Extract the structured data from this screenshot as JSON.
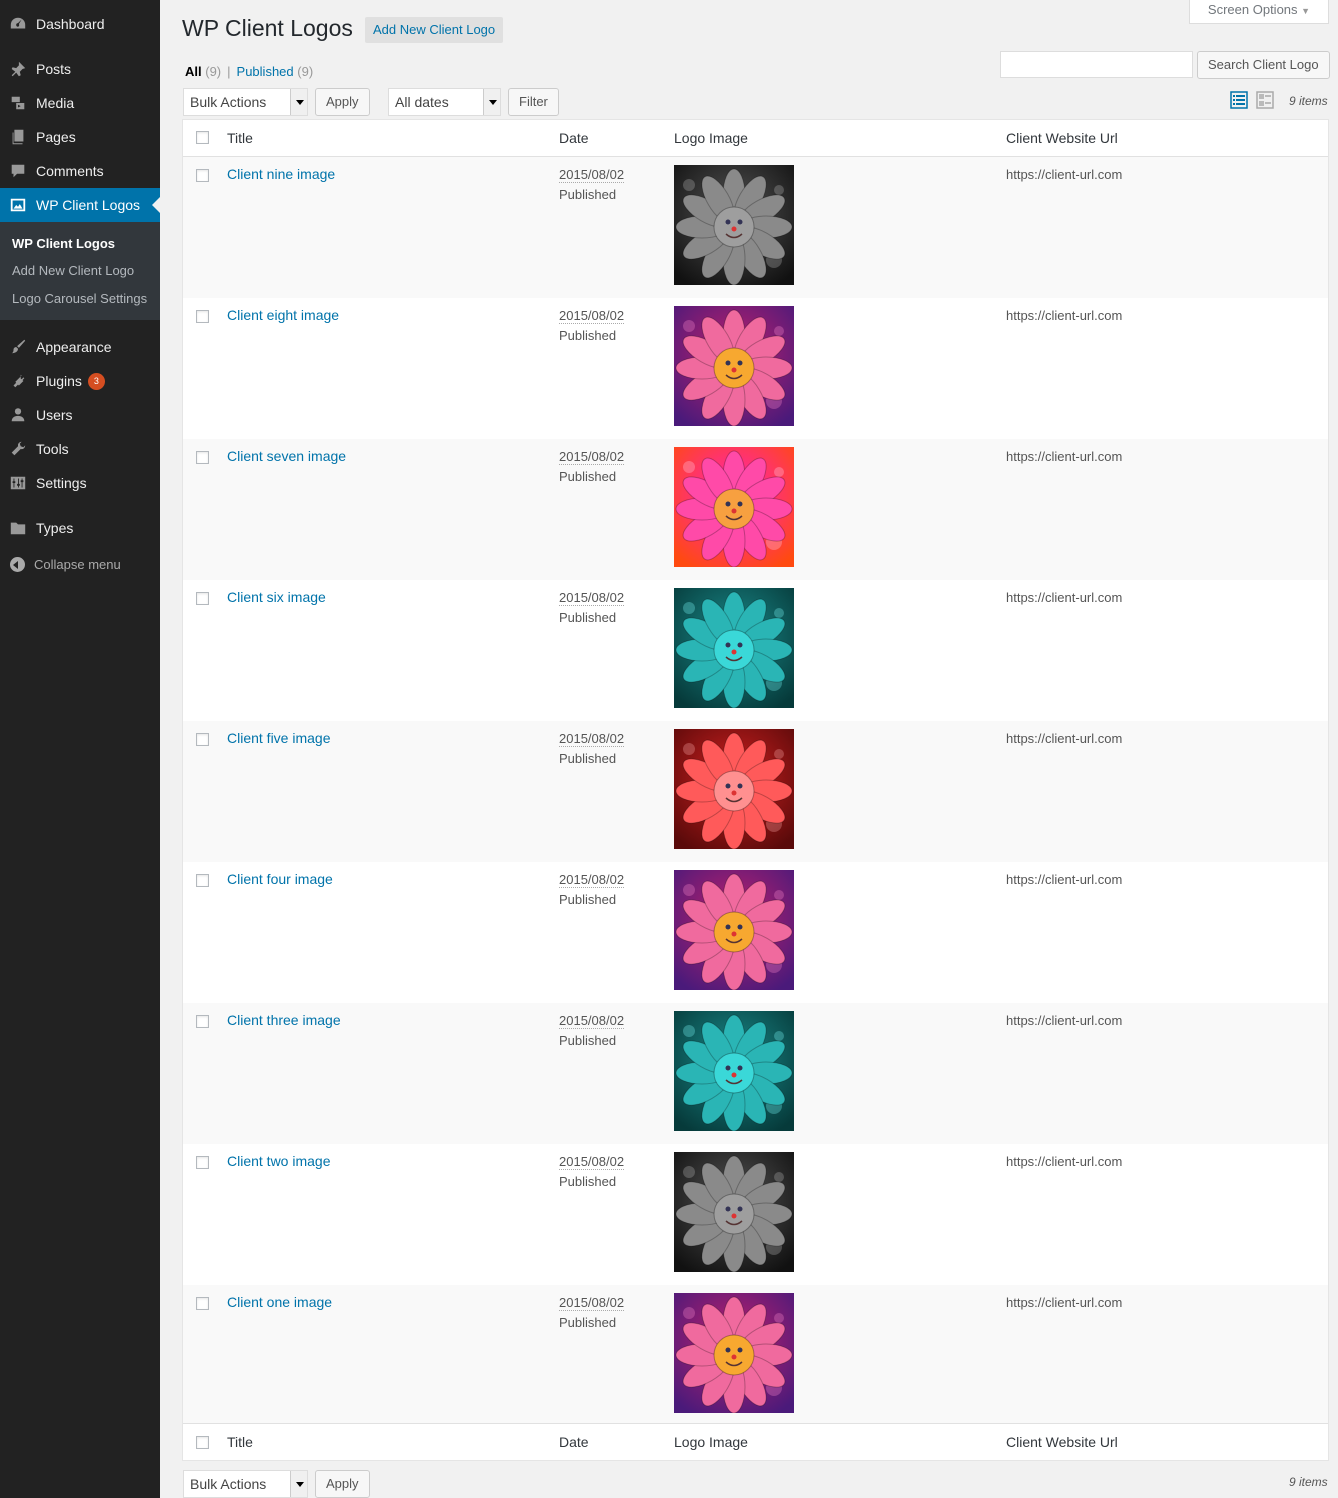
{
  "sidebar": {
    "items": [
      {
        "label": "Dashboard",
        "icon": "dashboard-icon"
      },
      {
        "label": "Posts",
        "icon": "pin-icon"
      },
      {
        "label": "Media",
        "icon": "media-icon"
      },
      {
        "label": "Pages",
        "icon": "pages-icon"
      },
      {
        "label": "Comments",
        "icon": "comment-icon"
      },
      {
        "label": "WP Client Logos",
        "icon": "image-icon"
      },
      {
        "label": "Appearance",
        "icon": "brush-icon"
      },
      {
        "label": "Plugins",
        "icon": "plug-icon",
        "badge": "3"
      },
      {
        "label": "Users",
        "icon": "user-icon"
      },
      {
        "label": "Tools",
        "icon": "wrench-icon"
      },
      {
        "label": "Settings",
        "icon": "sliders-icon"
      },
      {
        "label": "Types",
        "icon": "folder-icon"
      }
    ],
    "submenu": [
      "WP Client Logos",
      "Add New Client Logo",
      "Logo Carousel Settings"
    ],
    "collapse": "Collapse menu"
  },
  "header": {
    "title": "WP Client Logos",
    "add_new": "Add New Client Logo",
    "screen_options": "Screen Options"
  },
  "filters": {
    "all_label": "All",
    "all_count": "(9)",
    "separator": "|",
    "published_label": "Published",
    "published_count": "(9)",
    "search_button": "Search Client Logo",
    "bulk_actions": "Bulk Actions",
    "apply": "Apply",
    "all_dates": "All dates",
    "filter": "Filter",
    "items_count": "9 items"
  },
  "table": {
    "columns": [
      "Title",
      "Date",
      "Logo Image",
      "Client Website Url"
    ],
    "rows": [
      {
        "title": "Client nine image",
        "date": "2015/08/02",
        "status": "Published",
        "url": "https://client-url.com",
        "image_color": "gray"
      },
      {
        "title": "Client eight image",
        "date": "2015/08/02",
        "status": "Published",
        "url": "https://client-url.com",
        "image_color": "pink"
      },
      {
        "title": "Client seven image",
        "date": "2015/08/02",
        "status": "Published",
        "url": "https://client-url.com",
        "image_color": "magenta"
      },
      {
        "title": "Client six image",
        "date": "2015/08/02",
        "status": "Published",
        "url": "https://client-url.com",
        "image_color": "teal"
      },
      {
        "title": "Client five image",
        "date": "2015/08/02",
        "status": "Published",
        "url": "https://client-url.com",
        "image_color": "red"
      },
      {
        "title": "Client four image",
        "date": "2015/08/02",
        "status": "Published",
        "url": "https://client-url.com",
        "image_color": "pink"
      },
      {
        "title": "Client three image",
        "date": "2015/08/02",
        "status": "Published",
        "url": "https://client-url.com",
        "image_color": "teal"
      },
      {
        "title": "Client two image",
        "date": "2015/08/02",
        "status": "Published",
        "url": "https://client-url.com",
        "image_color": "gray"
      },
      {
        "title": "Client one image",
        "date": "2015/08/02",
        "status": "Published",
        "url": "https://client-url.com",
        "image_color": "pink"
      }
    ]
  },
  "colors": {
    "accent": "#0073aa",
    "sidebar_bg": "#222222",
    "badge": "#d54e21"
  }
}
